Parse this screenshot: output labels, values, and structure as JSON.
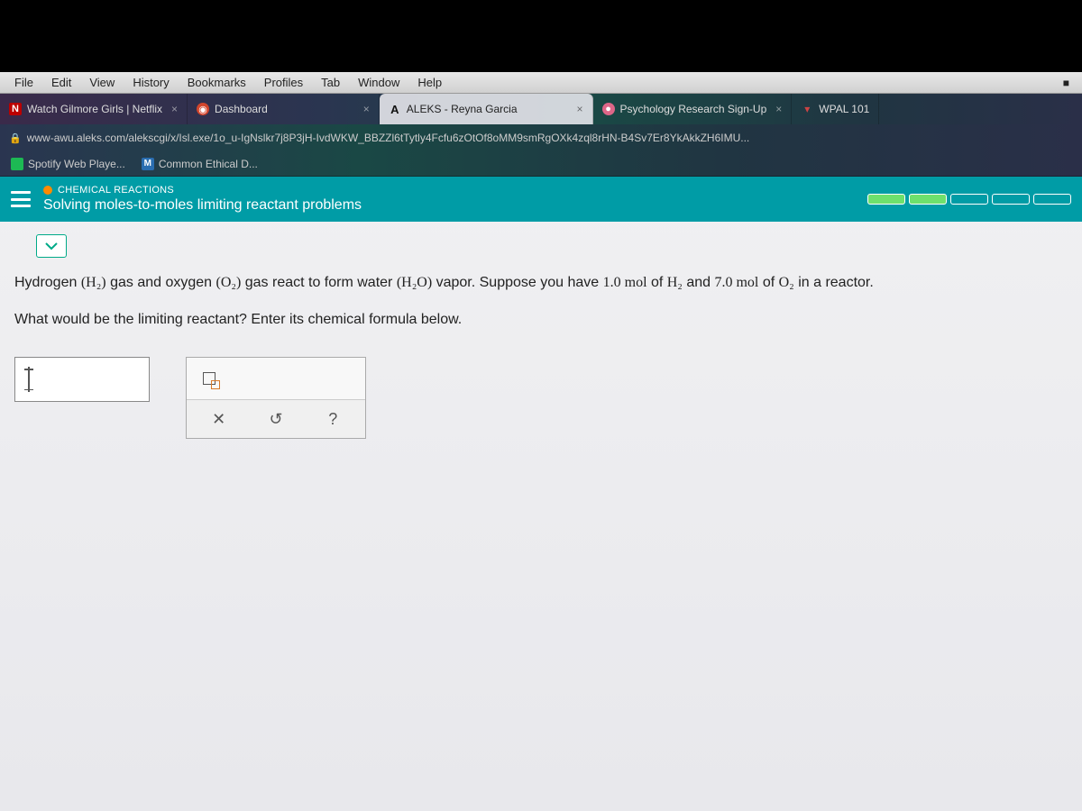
{
  "mac_menu": {
    "items": [
      "File",
      "Edit",
      "View",
      "History",
      "Bookmarks",
      "Profiles",
      "Tab",
      "Window",
      "Help"
    ],
    "battery_icon": "■"
  },
  "tabs": [
    {
      "fav": "N",
      "label": "Watch Gilmore Girls | Netflix",
      "active": false
    },
    {
      "fav": "◉",
      "label": "Dashboard",
      "active": false
    },
    {
      "fav": "A",
      "label": "ALEKS - Reyna Garcia",
      "active": true
    },
    {
      "fav": "●",
      "label": "Psychology Research Sign-Up",
      "active": false
    },
    {
      "fav": "▾",
      "label": "WPAL 101",
      "active": false
    }
  ],
  "url": "www-awu.aleks.com/alekscgi/x/Isl.exe/1o_u-IgNslkr7j8P3jH-IvdWKW_BBZZl6tTytly4Fcfu6zOtOf8oMM9smRgOXk4zql8rHN-B4Sv7Er8YkAkkZH6IMU...",
  "bookmarks": [
    {
      "icon": "spotify",
      "label": "Spotify Web Playe..."
    },
    {
      "icon": "M",
      "label": "Common Ethical D..."
    }
  ],
  "aleks": {
    "category": "CHEMICAL REACTIONS",
    "title": "Solving moles-to-moles limiting reactant problems",
    "progress": {
      "filled": 2,
      "total": 5
    }
  },
  "problem": {
    "line1_a": "Hydrogen ",
    "f1": "(H₂)",
    "line1_b": " gas and oxygen ",
    "f2": "(O₂)",
    "line1_c": " gas react to form water ",
    "f3": "(H₂O)",
    "line1_d": " vapor. Suppose you have ",
    "v1": "1.0 mol",
    "line1_e": " of ",
    "f4": "H₂",
    "line1_f": " and ",
    "v2": "7.0 mol",
    "line1_g": " of ",
    "f5": "O₂",
    "line1_h": " in a reactor.",
    "line2": "What would be the limiting reactant? Enter its chemical formula below."
  },
  "tools": {
    "clear": "✕",
    "reset": "↺",
    "help": "?"
  }
}
